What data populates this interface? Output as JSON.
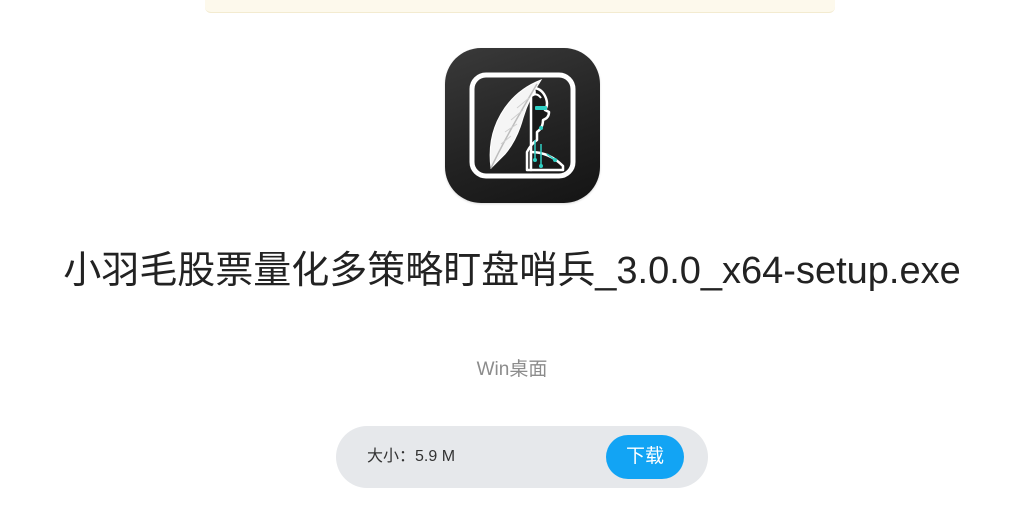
{
  "app": {
    "title": "小羽毛股票量化多策略盯盘哨兵_3.0.0_x64-setup.exe",
    "platform": "Win桌面",
    "icon": "feather-robot-logo-icon"
  },
  "download": {
    "size_label": "大小：",
    "size_value": "5.9 M",
    "button_label": "下载"
  },
  "colors": {
    "accent": "#12a4f4",
    "bar_background": "#e6e8eb",
    "icon_background": "#262626",
    "icon_highlight": "#2fd0c4"
  }
}
